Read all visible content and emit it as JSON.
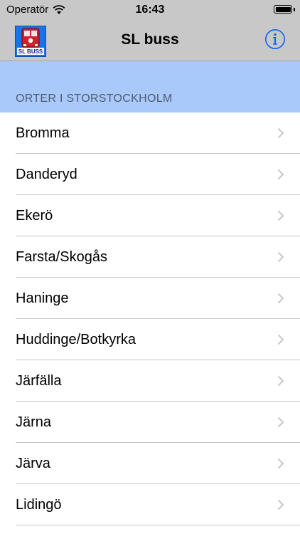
{
  "status": {
    "carrier": "Operatör",
    "time": "16:43"
  },
  "navbar": {
    "title": "SL buss",
    "logo_text": "SL BUSS"
  },
  "section": {
    "header": "ORTER I STORSTOCKHOLM"
  },
  "list": {
    "items": [
      {
        "label": "Bromma"
      },
      {
        "label": "Danderyd"
      },
      {
        "label": "Ekerö"
      },
      {
        "label": "Farsta/Skogås"
      },
      {
        "label": "Haninge"
      },
      {
        "label": "Huddinge/Botkyrka"
      },
      {
        "label": "Järfälla"
      },
      {
        "label": "Järna"
      },
      {
        "label": "Järva"
      },
      {
        "label": "Lidingö"
      }
    ]
  },
  "colors": {
    "accent": "#0a60ff",
    "bar": "#c8c8c8",
    "section_bg": "#a9c9fb"
  }
}
